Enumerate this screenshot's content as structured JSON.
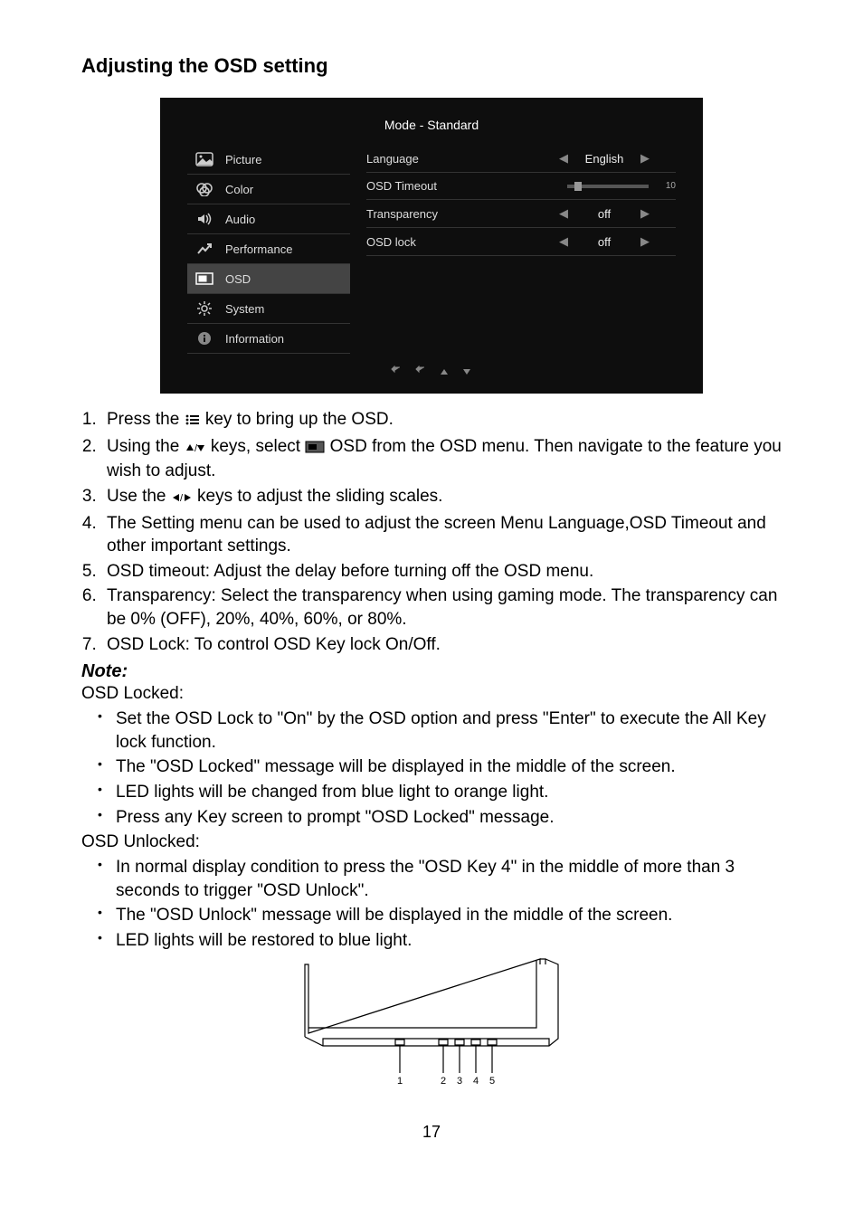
{
  "page": {
    "heading": "Adjusting the OSD setting",
    "number": "17"
  },
  "osd": {
    "title": "Mode - Standard",
    "sidebar": [
      {
        "label": "Picture",
        "icon": "picture"
      },
      {
        "label": "Color",
        "icon": "color"
      },
      {
        "label": "Audio",
        "icon": "audio"
      },
      {
        "label": "Performance",
        "icon": "performance"
      },
      {
        "label": "OSD",
        "icon": "osd",
        "selected": true
      },
      {
        "label": "System",
        "icon": "system"
      },
      {
        "label": "Information",
        "icon": "information"
      }
    ],
    "settings": [
      {
        "label": "Language",
        "value": "English",
        "arrows": true,
        "right": ""
      },
      {
        "label": "OSD Timeout",
        "slider": true,
        "right": "10"
      },
      {
        "label": "Transparency",
        "value": "off",
        "arrows": true,
        "right": ""
      },
      {
        "label": "OSD lock",
        "value": "off",
        "arrows": true,
        "right": ""
      }
    ]
  },
  "steps": [
    {
      "pre": "Press the ",
      "post": " key to bring up the OSD.",
      "icon": "menu"
    },
    {
      "pre": "Using the ",
      "mid1": " keys, select ",
      "mid2": " OSD from the OSD menu. Then navigate to the feature you wish to adjust.",
      "icon1": "updown",
      "icon2": "osdbox"
    },
    {
      "pre": "Use the ",
      "post": " keys to adjust the sliding scales.",
      "icon": "leftright"
    },
    {
      "text": "The Setting menu can be used to adjust the screen Menu Language,OSD Timeout and other important settings."
    },
    {
      "text": "OSD timeout: Adjust the delay before turning off the OSD menu."
    },
    {
      "text": "Transparency: Select the transparency when using gaming mode. The transparency can be 0% (OFF), 20%, 40%, 60%, or 80%."
    },
    {
      "text": "OSD Lock: To control OSD Key lock On/Off."
    }
  ],
  "note": {
    "heading": "Note:",
    "locked_h": "OSD Locked:",
    "locked": [
      "Set the OSD Lock to \"On\" by the OSD option and press \"Enter\" to execute the All Key lock function.",
      "The \"OSD Locked\" message will be displayed in the middle of the screen.",
      "LED lights will be changed from blue light to orange light.",
      "Press any Key screen to prompt \"OSD Locked\" message."
    ],
    "unlocked_h": "OSD Unlocked:",
    "unlocked": [
      "In normal display condition to press the \"OSD Key 4\" in the middle of more than 3 seconds to trigger \"OSD Unlock\".",
      "The \"OSD Unlock\" message will be displayed in the middle of the screen.",
      "LED lights will be restored to blue light."
    ]
  },
  "monitor": {
    "button_labels": [
      "1",
      "2",
      "3",
      "4",
      "5"
    ]
  }
}
